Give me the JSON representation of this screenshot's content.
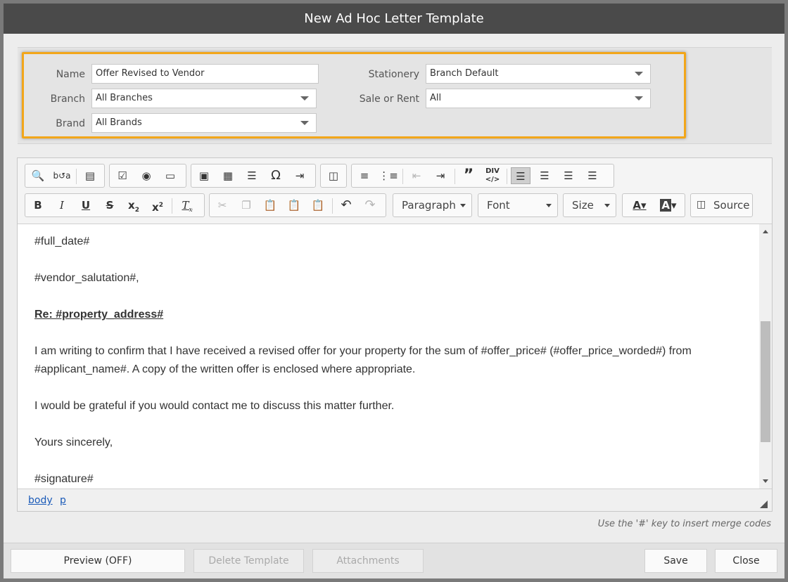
{
  "dialog": {
    "title": "New Ad Hoc Letter Template"
  },
  "form": {
    "name_label": "Name",
    "name_value": "Offer Revised to Vendor",
    "branch_label": "Branch",
    "branch_value": "All Branches",
    "brand_label": "Brand",
    "brand_value": "All Brands",
    "stationery_label": "Stationery",
    "stationery_value": "Branch Default",
    "sale_rent_label": "Sale or Rent",
    "sale_rent_value": "All"
  },
  "toolbar": {
    "paragraph": "Paragraph",
    "font": "Font",
    "size": "Size",
    "source": "Source",
    "icons": {
      "find": "search-icon",
      "replace": "replace-icon",
      "template": "template-icon",
      "checkbox": "checkbox-icon",
      "radio": "radio-icon",
      "textfield": "textfield-icon",
      "image": "image-icon",
      "table": "table-icon",
      "hr": "horizontal-line-icon",
      "special": "omega-icon",
      "pagebreak": "page-break-icon",
      "iframe": "iframe-icon",
      "ol": "numbered-list-icon",
      "ul": "bulleted-list-icon",
      "outdent": "outdent-icon",
      "indent": "indent-icon",
      "blockquote": "blockquote-icon",
      "div": "div-icon",
      "align_left": "align-left-icon",
      "align_center": "align-center-icon",
      "align_right": "align-right-icon",
      "justify": "justify-icon",
      "bold": "bold-icon",
      "italic": "italic-icon",
      "underline": "underline-icon",
      "strike": "strikethrough-icon",
      "subscript": "subscript-icon",
      "superscript": "superscript-icon",
      "clear_format": "clear-formatting-icon",
      "cut": "cut-icon",
      "copy": "copy-icon",
      "paste": "paste-icon",
      "paste_text": "paste-text-icon",
      "paste_word": "paste-word-icon",
      "undo": "undo-icon",
      "redo": "redo-icon",
      "text_color": "text-color-icon",
      "bg_color": "background-color-icon",
      "source": "source-icon"
    }
  },
  "content": {
    "p1": "#full_date#",
    "p2": "#vendor_salutation#,",
    "p3": "Re: #property_address#",
    "p4": "I am writing to confirm that I have received a revised offer for your property for the sum of #offer_price# (#offer_price_worded#) from #applicant_name#. A copy of the written offer is enclosed where appropriate.",
    "p5": "I would be grateful if you would contact me to discuss this matter further.",
    "p6": "Yours sincerely,",
    "p7": "#signature#"
  },
  "pathbar": {
    "body": "body",
    "p": "p"
  },
  "hint": "Use the '#' key to insert merge codes",
  "footer": {
    "preview": "Preview (OFF)",
    "delete": "Delete Template",
    "attachments": "Attachments",
    "save": "Save",
    "close": "Close"
  },
  "colors": {
    "highlight": "#f2a61a",
    "titlebar": "#4a4a4a",
    "link": "#1a5ab8"
  }
}
